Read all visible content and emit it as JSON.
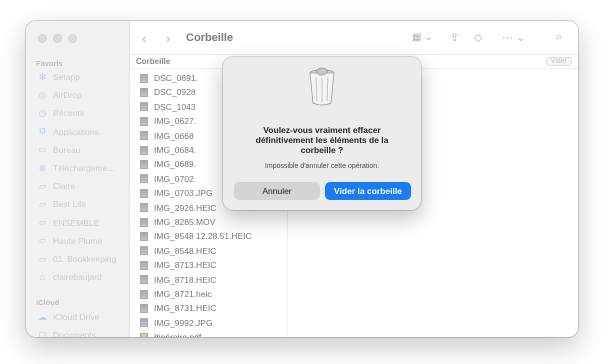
{
  "toolbar": {
    "title": "Corbeille",
    "back_icon": "chevron-left-icon",
    "forward_icon": "chevron-right-icon"
  },
  "path": {
    "crumb": "Corbeille",
    "empty_button": "Vider"
  },
  "sidebar": {
    "favoris_label": "Favoris",
    "favoris": [
      {
        "label": "Setapp",
        "icon": "setapp-icon"
      },
      {
        "label": "AirDrop",
        "icon": "airdrop-icon"
      },
      {
        "label": "Récents",
        "icon": "clock-icon"
      },
      {
        "label": "Applications",
        "icon": "apps-icon"
      },
      {
        "label": "Bureau",
        "icon": "desktop-icon"
      },
      {
        "label": "Téléchargeme...",
        "icon": "download-icon"
      },
      {
        "label": "Claire",
        "icon": "folder-icon"
      },
      {
        "label": "Best Life",
        "icon": "folder-icon"
      },
      {
        "label": "ENSEMBLE",
        "icon": "folder-icon"
      },
      {
        "label": "Haute Plume",
        "icon": "folder-icon"
      },
      {
        "label": "01. Bookkeeping",
        "icon": "folder-icon"
      },
      {
        "label": "clairebaujard",
        "icon": "home-icon"
      }
    ],
    "icloud_label": "iCloud",
    "icloud": [
      {
        "label": "iCloud Drive",
        "icon": "cloud-icon"
      },
      {
        "label": "Documents",
        "icon": "doc-icon"
      }
    ]
  },
  "files": [
    "DSC_0691.",
    "DSC_0928",
    "DSC_1043",
    "IMG_0627.",
    "IMG_0668",
    "IMG_0684.",
    "IMG_0689.",
    "IMG_0702.",
    "IMG_0703.JPG",
    "IMG_2926.HEIC",
    "IMG_8285.MOV",
    "IMG_8548 12.28.51.HEIC",
    "IMG_8548.HEIC",
    "IMG_8713.HEIC",
    "IMG_8718.HEIC",
    "IMG_8721.heic",
    "IMG_8731.HEIC",
    "IMG_9992.JPG",
    "Itinéraire.pdf"
  ],
  "dialog": {
    "title": "Voulez-vous vraiment effacer définitivement les éléments de la corbeille ?",
    "subtitle": "Impossible d'annuler cette opération.",
    "cancel_label": "Annuler",
    "confirm_label": "Vider la corbeille",
    "accent_color": "#1b7cf0"
  }
}
